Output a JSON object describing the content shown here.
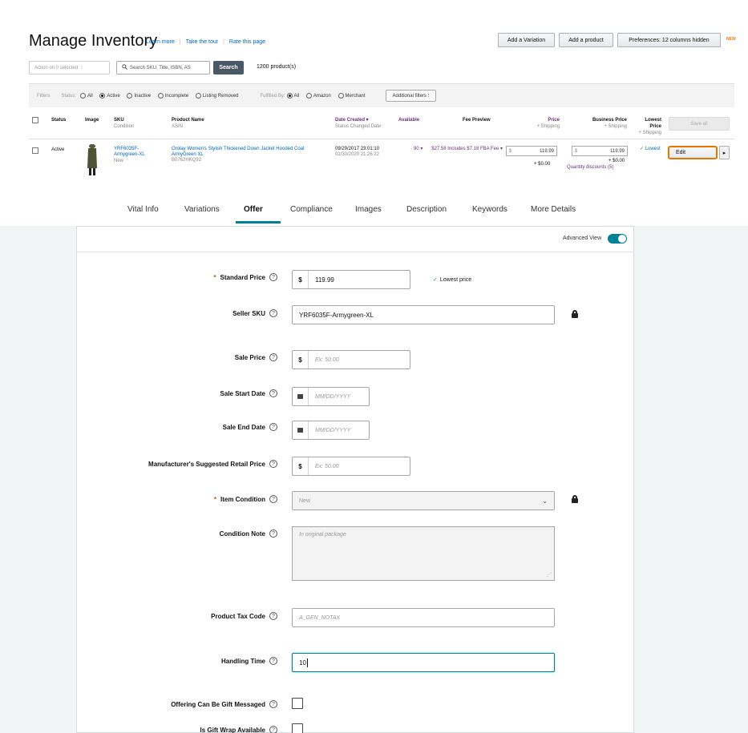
{
  "header": {
    "title": "Manage Inventory",
    "links": [
      "Learn more",
      "Take the tour",
      "Rate this page"
    ],
    "buttons": {
      "add_variation": "Add a Variation",
      "add_product": "Add a product",
      "preferences": "Preferences: 12 columns hidden"
    },
    "new_tag": "NEW"
  },
  "toolbar": {
    "action_select": "Action on 0 selected",
    "search_placeholder": "Search SKU, Title, ISBN, AS",
    "search_button": "Search",
    "product_count": "1200 product(s)"
  },
  "filters": {
    "label": "Filters",
    "status_label": "Status:",
    "status_options": [
      "All",
      "Active",
      "Inactive",
      "Incomplete",
      "Listing Removed"
    ],
    "status_selected": "Active",
    "fulfilled_label": "Fulfilled By:",
    "fulfilled_options": [
      "All",
      "Amazon",
      "Merchant"
    ],
    "fulfilled_selected": "All",
    "additional": "Additional filters"
  },
  "table": {
    "headers": {
      "status": "Status",
      "image": "Image",
      "sku": "SKU",
      "sku_sub": "Condition",
      "product_name": "Product Name",
      "product_sub": "ASIN",
      "date_created": "Date Created",
      "date_sub": "Status Changed Date",
      "available": "Available",
      "fee_preview": "Fee Preview",
      "price": "Price",
      "price_sub": "+ Shipping",
      "business_price": "Business Price",
      "business_sub": "+ Shipping",
      "lowest_price": "Lowest Price",
      "lowest_sub": "+ Shipping",
      "save_all": "Save all"
    },
    "row": {
      "status": "Active",
      "sku": "YRF6035F-Armygreen-XL",
      "condition": "New",
      "product_name": "Orolay Women's Stylish Thickened Down Jacket Hooded Coat ArmyGreen XL",
      "asin": "B0762HKQ92",
      "date_created": "09/29/2017 23:01:10",
      "status_changed": "01/30/2020 21:26:22",
      "available": "90",
      "fee_preview": "$27.58 Includes $7.18 FBA Fee",
      "price": "119.99",
      "shipping": "+ $0.00",
      "business_price": "119.99",
      "business_shipping": "+ $0.00",
      "quantity_discounts": "Quantity discounts (5)",
      "lowest": "Lowest",
      "edit": "Edit"
    }
  },
  "tabs": [
    "Vital Info",
    "Variations",
    "Offer",
    "Compliance",
    "Images",
    "Description",
    "Keywords",
    "More Details"
  ],
  "active_tab": "Offer",
  "form": {
    "advanced_view": "Advanced View",
    "advanced_view_on": true,
    "standard_price": {
      "label": "Standard Price",
      "currency": "$",
      "value": "119.99",
      "note": "Lowest price"
    },
    "seller_sku": {
      "label": "Seller SKU",
      "value": "YRF6035F-Armygreen-XL"
    },
    "sale_price": {
      "label": "Sale Price",
      "currency": "$",
      "placeholder": "Ex: 50.00"
    },
    "sale_start": {
      "label": "Sale Start Date",
      "placeholder": "MM/DD/YYYY"
    },
    "sale_end": {
      "label": "Sale End Date",
      "placeholder": "MM/DD/YYYY"
    },
    "msrp": {
      "label": "Manufacturer's Suggested Retail Price",
      "currency": "$",
      "placeholder": "Ex: 50.00"
    },
    "item_condition": {
      "label": "Item Condition",
      "value": "New"
    },
    "condition_note": {
      "label": "Condition Note",
      "placeholder": "In original package"
    },
    "tax_code": {
      "label": "Product Tax Code",
      "placeholder": "A_GEN_NOTAX"
    },
    "handling_time": {
      "label": "Handling Time",
      "value": "10"
    },
    "gift_message": {
      "label": "Offering Can Be Gift Messaged"
    },
    "gift_wrap": {
      "label": "Is Gift Wrap Available"
    }
  }
}
